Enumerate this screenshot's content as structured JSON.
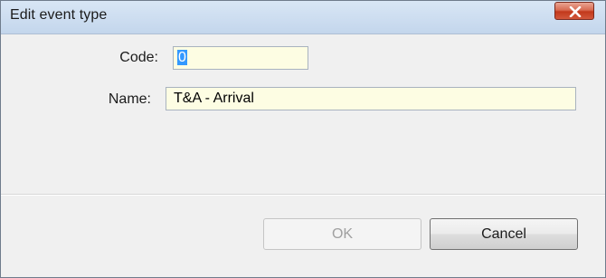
{
  "window": {
    "title": "Edit event type",
    "close_icon": "close-icon"
  },
  "form": {
    "code_label": "Code:",
    "code_value": "0",
    "name_label": "Name:",
    "name_value": "T&A - Arrival"
  },
  "buttons": {
    "ok_label": "OK",
    "ok_enabled": false,
    "cancel_label": "Cancel"
  },
  "colors": {
    "field_background": "#fdfde3",
    "selection_highlight": "#3399ff",
    "close_button": "#c2391c"
  }
}
